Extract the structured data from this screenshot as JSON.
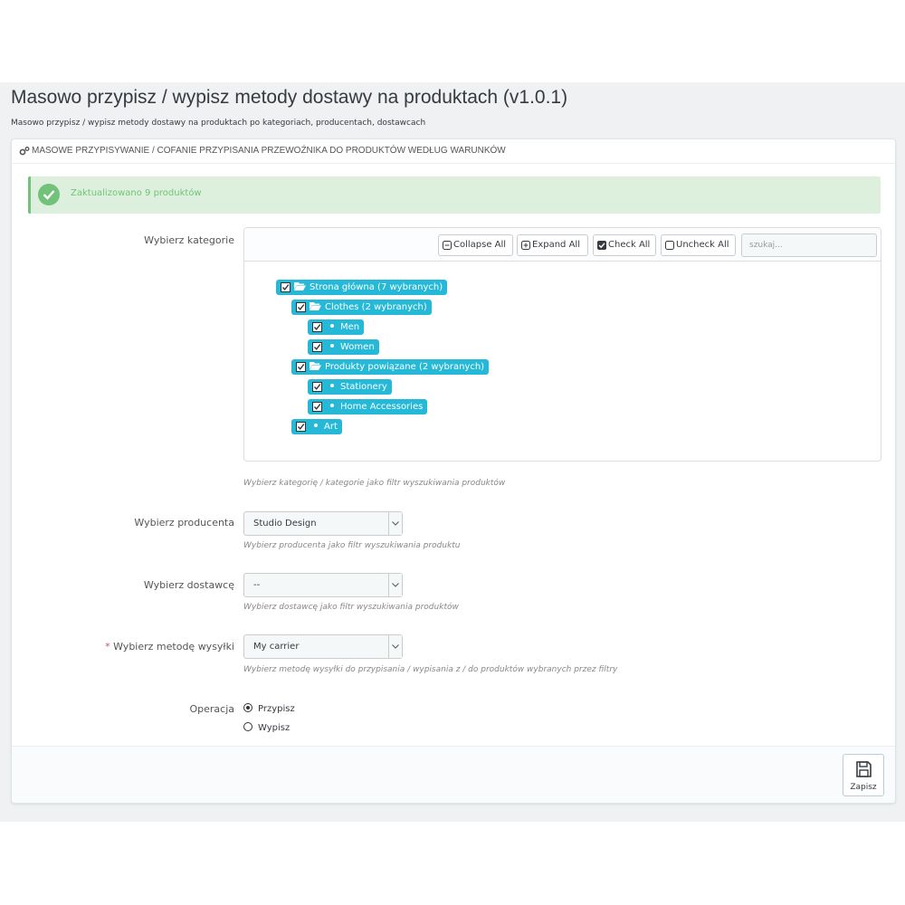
{
  "header": {
    "title": "Masowo przypisz / wypisz metody dostawy na produktach (v1.0.1)",
    "subtitle": "Masowo przypisz / wypisz metody dostawy na produktach po kategoriach, producentach, dostawcach"
  },
  "panel": {
    "heading": "MASOWE PRZYPISYWANIE / COFANIE PRZYPISANIA PRZEWOŹNIKA DO PRODUKTÓW WEDŁUG WARUNKÓW",
    "heading_icon": "cogs-icon"
  },
  "alert": {
    "text": "Zaktualizowano 9 produktów",
    "icon": "check-circle-icon",
    "color": "#72c279"
  },
  "category": {
    "label": "Wybierz kategorie",
    "help": "Wybierz kategorię / kategorie jako filtr wyszukiwania produktów",
    "toolbar": {
      "collapse_all": "Collapse All",
      "expand_all": "Expand All",
      "check_all": "Check All",
      "uncheck_all": "Uncheck All",
      "search_placeholder": "szukaj..."
    },
    "tree": [
      {
        "label": "Strona główna (7 wybranych)",
        "type": "folder",
        "checked": true,
        "level": 0
      },
      {
        "label": "Clothes (2 wybranych)",
        "type": "folder",
        "checked": true,
        "level": 1
      },
      {
        "label": "Men",
        "type": "leaf",
        "checked": true,
        "level": 2
      },
      {
        "label": "Women",
        "type": "leaf",
        "checked": true,
        "level": 2
      },
      {
        "label": "Produkty powiązane (2 wybranych)",
        "type": "folder",
        "checked": true,
        "level": 1
      },
      {
        "label": "Stationery",
        "type": "leaf",
        "checked": true,
        "level": 2
      },
      {
        "label": "Home Accessories",
        "type": "leaf",
        "checked": true,
        "level": 2
      },
      {
        "label": "Art",
        "type": "leaf",
        "checked": true,
        "level": 1
      }
    ],
    "accent_color": "#25b9d7"
  },
  "manufacturer": {
    "label": "Wybierz producenta",
    "value": "Studio Design",
    "help": "Wybierz producenta jako filtr wyszukiwania produktu"
  },
  "supplier": {
    "label": "Wybierz dostawcę",
    "value": "--",
    "help": "Wybierz dostawcę jako filtr wyszukiwania produktów"
  },
  "carrier": {
    "required_mark": "*",
    "label": "Wybierz metodę wysyłki",
    "value": "My carrier",
    "help": "Wybierz metodę wysyłki do przypisania / wypisania z / do produktów wybranych przez filtry"
  },
  "operation": {
    "label": "Operacja",
    "options": [
      {
        "label": "Przypisz",
        "selected": true
      },
      {
        "label": "Wypisz",
        "selected": false
      }
    ]
  },
  "footer": {
    "save_label": "Zapisz",
    "save_icon": "floppy-disk-icon"
  }
}
